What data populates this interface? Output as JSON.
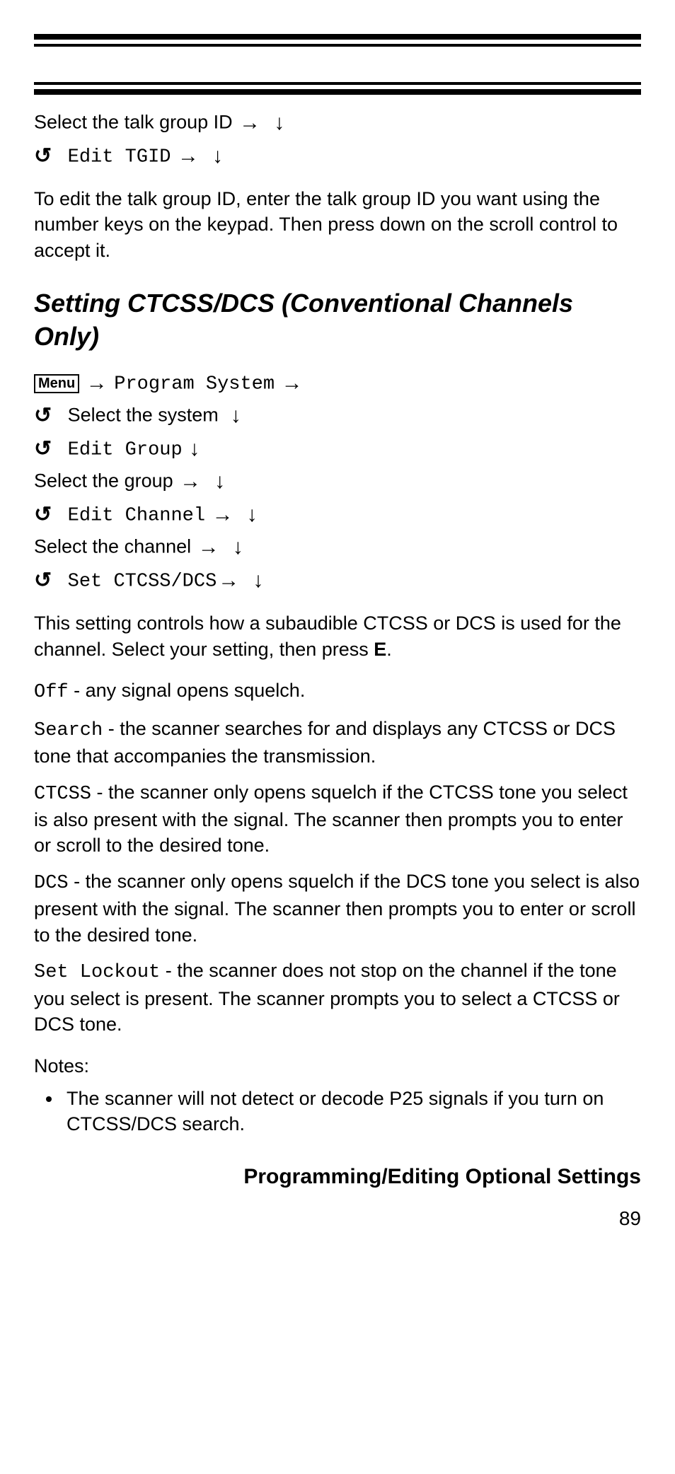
{
  "intro": {
    "step1_pre": "Select the talk group ID",
    "step2_menu": "Edit TGID",
    "para1": "To edit the talk group ID, enter the talk group ID you want using the number keys on the keypad. Then press down on the scroll control to accept it."
  },
  "heading": "Setting CTCSS/DCS (Conventional Channels Only)",
  "menu_chip": "Menu",
  "nav": {
    "program_system": "Program System",
    "select_system": "Select the system",
    "edit_group": "Edit Group",
    "select_group": "Select the group",
    "edit_channel": "Edit Channel",
    "select_channel": "Select the channel",
    "set_ctcss": "Set CTCSS/DCS"
  },
  "para2_a": "This setting controls how a subaudible CTCSS or DCS is used for the channel. Select your setting, then press ",
  "para2_b": "E",
  "para2_c": ".",
  "options": {
    "off_label": "Off",
    "off_text": " - any signal opens squelch.",
    "search_label": "Search",
    "search_text": " - the scanner searches for and displays any CTCSS or DCS tone that accompanies the transmission.",
    "ctcss_label": "CTCSS",
    "ctcss_text": " - the scanner only opens squelch if the CTCSS tone you select is also present with the signal. The scanner then prompts you to enter or scroll to the desired tone.",
    "dcs_label": "DCS",
    "dcs_text": " - the scanner only opens squelch if the DCS tone you select is also present with the signal. The scanner then prompts you to enter or scroll to the desired tone.",
    "lockout_label": "Set Lockout",
    "lockout_text": " - the scanner does not stop on the channel if the tone you select is present. The scanner prompts you to select a CTCSS or DCS tone."
  },
  "notes_label": "Notes:",
  "notes": [
    "The scanner will not detect or decode P25 signals if you turn on CTCSS/DCS search."
  ],
  "footer_title": "Programming/Editing Optional Settings",
  "page_num": "89"
}
